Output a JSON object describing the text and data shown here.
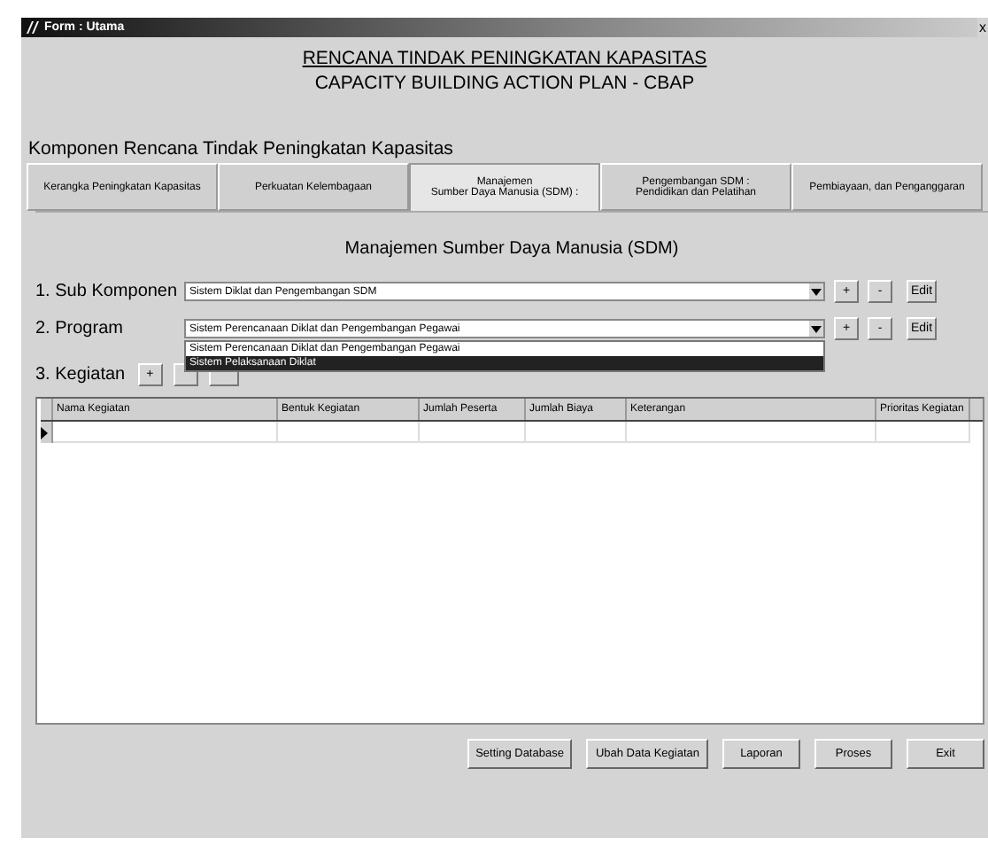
{
  "window": {
    "title": "Form : Utama",
    "close": "x"
  },
  "heading": {
    "title": "RENCANA TINDAK PENINGKATAN KAPASITAS",
    "subtitle": "CAPACITY BUILDING ACTION PLAN - CBAP"
  },
  "section_label": "Komponen Rencana Tindak Peningkatan Kapasitas",
  "tabs": [
    {
      "label": "Kerangka Peningkatan Kapasitas",
      "selected": false
    },
    {
      "label": "Perkuatan Kelembagaan",
      "selected": false
    },
    {
      "label": "Manajemen\nSumber Daya Manusia (SDM) :",
      "selected": true
    },
    {
      "label": "Pengembangan SDM :\nPendidikan dan Pelatihan",
      "selected": false
    },
    {
      "label": "Pembiayaan, dan Penganggaran",
      "selected": false
    }
  ],
  "panel_title": "Manajemen Sumber Daya Manusia (SDM)",
  "rows": [
    {
      "label": "1. Sub Komponen",
      "value": "Sistem Diklat dan Pengembangan SDM",
      "buttons": [
        "+",
        "-",
        "Edit"
      ]
    },
    {
      "label": "2. Program",
      "value": "Sistem Perencanaan Diklat dan Pengembangan Pegawai",
      "buttons": [
        "+",
        "-",
        "Edit"
      ]
    }
  ],
  "dropdown": [
    {
      "label": "Sistem Perencanaan Diklat dan Pengembangan Pegawai",
      "selected": false
    },
    {
      "label": "Sistem Pelaksanaan Diklat",
      "selected": true
    }
  ],
  "kegiatan": {
    "label": "3. Kegiatan",
    "buttons": [
      "+"
    ]
  },
  "table": {
    "columns": [
      "Nama Kegiatan",
      "Bentuk Kegiatan",
      "Jumlah Peserta",
      "Jumlah Biaya",
      "Keterangan",
      "Prioritas Kegiatan"
    ]
  },
  "buttons": [
    "Setting Database",
    "Ubah Data Kegiatan",
    "Laporan",
    "Proses",
    "Exit"
  ]
}
